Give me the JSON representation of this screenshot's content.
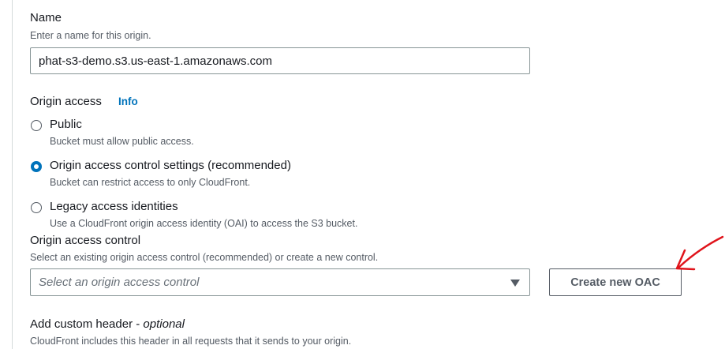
{
  "name_field": {
    "label": "Name",
    "description": "Enter a name for this origin.",
    "value": "phat-s3-demo.s3.us-east-1.amazonaws.com"
  },
  "origin_access": {
    "label": "Origin access",
    "info_link": "Info",
    "options": [
      {
        "label": "Public",
        "description": "Bucket must allow public access.",
        "selected": false
      },
      {
        "label": "Origin access control settings (recommended)",
        "description": "Bucket can restrict access to only CloudFront.",
        "selected": true
      },
      {
        "label": "Legacy access identities",
        "description": "Use a CloudFront origin access identity (OAI) to access the S3 bucket.",
        "selected": false
      }
    ]
  },
  "origin_access_control": {
    "label": "Origin access control",
    "description": "Select an existing origin access control (recommended) or create a new control.",
    "select_placeholder": "Select an origin access control",
    "create_button": "Create new OAC"
  },
  "custom_header": {
    "label": "Add custom header",
    "label_suffix": "optional",
    "description": "CloudFront includes this header in all requests that it sends to your origin."
  },
  "colors": {
    "accent": "#0073bb",
    "annotation": "#e0141b"
  }
}
